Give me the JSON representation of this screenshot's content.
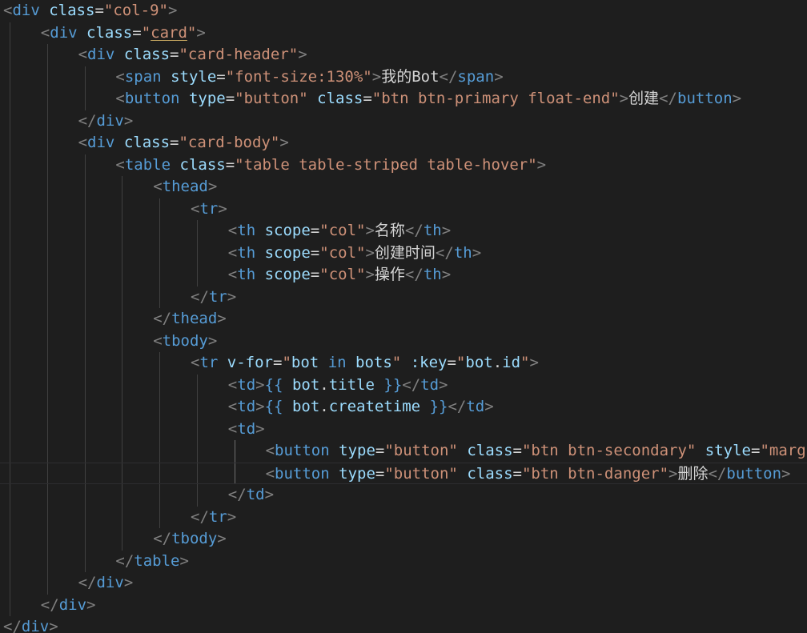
{
  "editor": {
    "language": "html",
    "theme": "dark",
    "colors": {
      "background": "#1e1e1e",
      "punctuation": "#808080",
      "tag": "#569cd6",
      "attribute": "#9cdcfe",
      "string": "#ce9178",
      "text": "#d4d4d4"
    },
    "lines": [
      {
        "indent": 0,
        "tokens": [
          [
            "p",
            "<"
          ],
          [
            "t",
            "div"
          ],
          [
            "x",
            " "
          ],
          [
            "a",
            "class"
          ],
          [
            "x",
            "="
          ],
          [
            "s",
            "\"col-9\""
          ],
          [
            "p",
            ">"
          ]
        ]
      },
      {
        "indent": 1,
        "tokens": [
          [
            "p",
            "<"
          ],
          [
            "t",
            "div"
          ],
          [
            "x",
            " "
          ],
          [
            "a",
            "class"
          ],
          [
            "x",
            "="
          ],
          [
            "s",
            "\""
          ],
          [
            "su",
            "card"
          ],
          [
            "s",
            "\""
          ],
          [
            "p",
            ">"
          ]
        ]
      },
      {
        "indent": 2,
        "tokens": [
          [
            "p",
            "<"
          ],
          [
            "t",
            "div"
          ],
          [
            "x",
            " "
          ],
          [
            "a",
            "class"
          ],
          [
            "x",
            "="
          ],
          [
            "s",
            "\"card-header\""
          ],
          [
            "p",
            ">"
          ]
        ]
      },
      {
        "indent": 3,
        "tokens": [
          [
            "p",
            "<"
          ],
          [
            "t",
            "span"
          ],
          [
            "x",
            " "
          ],
          [
            "a",
            "style"
          ],
          [
            "x",
            "="
          ],
          [
            "s",
            "\"font-size:130%\""
          ],
          [
            "p",
            ">"
          ],
          [
            "x",
            "我的Bot"
          ],
          [
            "p",
            "</"
          ],
          [
            "t",
            "span"
          ],
          [
            "p",
            ">"
          ]
        ]
      },
      {
        "indent": 3,
        "tokens": [
          [
            "p",
            "<"
          ],
          [
            "t",
            "button"
          ],
          [
            "x",
            " "
          ],
          [
            "a",
            "type"
          ],
          [
            "x",
            "="
          ],
          [
            "s",
            "\"button\""
          ],
          [
            "x",
            " "
          ],
          [
            "a",
            "class"
          ],
          [
            "x",
            "="
          ],
          [
            "s",
            "\"btn btn-primary float-end\""
          ],
          [
            "p",
            ">"
          ],
          [
            "x",
            "创建"
          ],
          [
            "p",
            "</"
          ],
          [
            "t",
            "button"
          ],
          [
            "p",
            ">"
          ]
        ]
      },
      {
        "indent": 2,
        "tokens": [
          [
            "p",
            "</"
          ],
          [
            "t",
            "div"
          ],
          [
            "p",
            ">"
          ]
        ]
      },
      {
        "indent": 2,
        "tokens": [
          [
            "p",
            "<"
          ],
          [
            "t",
            "div"
          ],
          [
            "x",
            " "
          ],
          [
            "a",
            "class"
          ],
          [
            "x",
            "="
          ],
          [
            "s",
            "\"card-body\""
          ],
          [
            "p",
            ">"
          ]
        ]
      },
      {
        "indent": 3,
        "tokens": [
          [
            "p",
            "<"
          ],
          [
            "t",
            "table"
          ],
          [
            "x",
            " "
          ],
          [
            "a",
            "class"
          ],
          [
            "x",
            "="
          ],
          [
            "s",
            "\"table table-striped table-hover\""
          ],
          [
            "p",
            ">"
          ]
        ]
      },
      {
        "indent": 4,
        "tokens": [
          [
            "p",
            "<"
          ],
          [
            "t",
            "thead"
          ],
          [
            "p",
            ">"
          ]
        ]
      },
      {
        "indent": 5,
        "tokens": [
          [
            "p",
            "<"
          ],
          [
            "t",
            "tr"
          ],
          [
            "p",
            ">"
          ]
        ]
      },
      {
        "indent": 6,
        "tokens": [
          [
            "p",
            "<"
          ],
          [
            "t",
            "th"
          ],
          [
            "x",
            " "
          ],
          [
            "a",
            "scope"
          ],
          [
            "x",
            "="
          ],
          [
            "s",
            "\"col\""
          ],
          [
            "p",
            ">"
          ],
          [
            "x",
            "名称"
          ],
          [
            "p",
            "</"
          ],
          [
            "t",
            "th"
          ],
          [
            "p",
            ">"
          ]
        ]
      },
      {
        "indent": 6,
        "tokens": [
          [
            "p",
            "<"
          ],
          [
            "t",
            "th"
          ],
          [
            "x",
            " "
          ],
          [
            "a",
            "scope"
          ],
          [
            "x",
            "="
          ],
          [
            "s",
            "\"col\""
          ],
          [
            "p",
            ">"
          ],
          [
            "x",
            "创建时间"
          ],
          [
            "p",
            "</"
          ],
          [
            "t",
            "th"
          ],
          [
            "p",
            ">"
          ]
        ]
      },
      {
        "indent": 6,
        "tokens": [
          [
            "p",
            "<"
          ],
          [
            "t",
            "th"
          ],
          [
            "x",
            " "
          ],
          [
            "a",
            "scope"
          ],
          [
            "x",
            "="
          ],
          [
            "s",
            "\"col\""
          ],
          [
            "p",
            ">"
          ],
          [
            "x",
            "操作"
          ],
          [
            "p",
            "</"
          ],
          [
            "t",
            "th"
          ],
          [
            "p",
            ">"
          ]
        ]
      },
      {
        "indent": 5,
        "tokens": [
          [
            "p",
            "</"
          ],
          [
            "t",
            "tr"
          ],
          [
            "p",
            ">"
          ]
        ]
      },
      {
        "indent": 4,
        "tokens": [
          [
            "p",
            "</"
          ],
          [
            "t",
            "thead"
          ],
          [
            "p",
            ">"
          ]
        ]
      },
      {
        "indent": 4,
        "tokens": [
          [
            "p",
            "<"
          ],
          [
            "t",
            "tbody"
          ],
          [
            "p",
            ">"
          ]
        ]
      },
      {
        "indent": 5,
        "tokens": [
          [
            "p",
            "<"
          ],
          [
            "t",
            "tr"
          ],
          [
            "x",
            " "
          ],
          [
            "a",
            "v-for"
          ],
          [
            "x",
            "="
          ],
          [
            "s",
            "\""
          ],
          [
            "v",
            "bot"
          ],
          [
            "x",
            " "
          ],
          [
            "t",
            "in"
          ],
          [
            "x",
            " "
          ],
          [
            "v",
            "bots"
          ],
          [
            "s",
            "\""
          ],
          [
            "x",
            " "
          ],
          [
            "a",
            ":key"
          ],
          [
            "x",
            "="
          ],
          [
            "s",
            "\""
          ],
          [
            "v",
            "bot"
          ],
          [
            "x",
            "."
          ],
          [
            "v",
            "id"
          ],
          [
            "s",
            "\""
          ],
          [
            "p",
            ">"
          ]
        ]
      },
      {
        "indent": 6,
        "tokens": [
          [
            "p",
            "<"
          ],
          [
            "t",
            "td"
          ],
          [
            "p",
            ">"
          ],
          [
            "t",
            "{{"
          ],
          [
            "x",
            " "
          ],
          [
            "v",
            "bot"
          ],
          [
            "x",
            "."
          ],
          [
            "v",
            "title"
          ],
          [
            "x",
            " "
          ],
          [
            "t",
            "}}"
          ],
          [
            "p",
            "</"
          ],
          [
            "t",
            "td"
          ],
          [
            "p",
            ">"
          ]
        ]
      },
      {
        "indent": 6,
        "tokens": [
          [
            "p",
            "<"
          ],
          [
            "t",
            "td"
          ],
          [
            "p",
            ">"
          ],
          [
            "t",
            "{{"
          ],
          [
            "x",
            " "
          ],
          [
            "v",
            "bot"
          ],
          [
            "x",
            "."
          ],
          [
            "v",
            "createtime"
          ],
          [
            "x",
            " "
          ],
          [
            "t",
            "}}"
          ],
          [
            "p",
            "</"
          ],
          [
            "t",
            "td"
          ],
          [
            "p",
            ">"
          ]
        ]
      },
      {
        "indent": 6,
        "tokens": [
          [
            "p",
            "<"
          ],
          [
            "t",
            "td"
          ],
          [
            "p",
            ">"
          ]
        ]
      },
      {
        "indent": 7,
        "tokens": [
          [
            "p",
            "<"
          ],
          [
            "t",
            "button"
          ],
          [
            "x",
            " "
          ],
          [
            "a",
            "type"
          ],
          [
            "x",
            "="
          ],
          [
            "s",
            "\"button\""
          ],
          [
            "x",
            " "
          ],
          [
            "a",
            "class"
          ],
          [
            "x",
            "="
          ],
          [
            "s",
            "\"btn btn-secondary\""
          ],
          [
            "x",
            " "
          ],
          [
            "a",
            "style"
          ],
          [
            "x",
            "="
          ],
          [
            "s",
            "\"marg"
          ]
        ]
      },
      {
        "indent": 7,
        "current": true,
        "tokens": [
          [
            "p",
            "<"
          ],
          [
            "t",
            "button"
          ],
          [
            "x",
            " "
          ],
          [
            "a",
            "type"
          ],
          [
            "x",
            "="
          ],
          [
            "s",
            "\"button\""
          ],
          [
            "x",
            " "
          ],
          [
            "a",
            "class"
          ],
          [
            "x",
            "="
          ],
          [
            "s",
            "\"btn btn-danger\""
          ],
          [
            "p",
            ">"
          ],
          [
            "x",
            "删除"
          ],
          [
            "p",
            "</"
          ],
          [
            "t",
            "button"
          ],
          [
            "p",
            ">"
          ]
        ]
      },
      {
        "indent": 6,
        "tokens": [
          [
            "p",
            "</"
          ],
          [
            "t",
            "td"
          ],
          [
            "p",
            ">"
          ]
        ]
      },
      {
        "indent": 5,
        "tokens": [
          [
            "p",
            "</"
          ],
          [
            "t",
            "tr"
          ],
          [
            "p",
            ">"
          ]
        ]
      },
      {
        "indent": 4,
        "tokens": [
          [
            "p",
            "</"
          ],
          [
            "t",
            "tbody"
          ],
          [
            "p",
            ">"
          ]
        ]
      },
      {
        "indent": 3,
        "tokens": [
          [
            "p",
            "</"
          ],
          [
            "t",
            "table"
          ],
          [
            "p",
            ">"
          ]
        ]
      },
      {
        "indent": 2,
        "tokens": [
          [
            "p",
            "</"
          ],
          [
            "t",
            "div"
          ],
          [
            "p",
            ">"
          ]
        ]
      },
      {
        "indent": 1,
        "tokens": [
          [
            "p",
            "</"
          ],
          [
            "t",
            "div"
          ],
          [
            "p",
            ">"
          ]
        ]
      },
      {
        "indent": 0,
        "tokens": [
          [
            "p",
            "</"
          ],
          [
            "t",
            "div"
          ],
          [
            "p",
            ">"
          ]
        ]
      }
    ]
  }
}
